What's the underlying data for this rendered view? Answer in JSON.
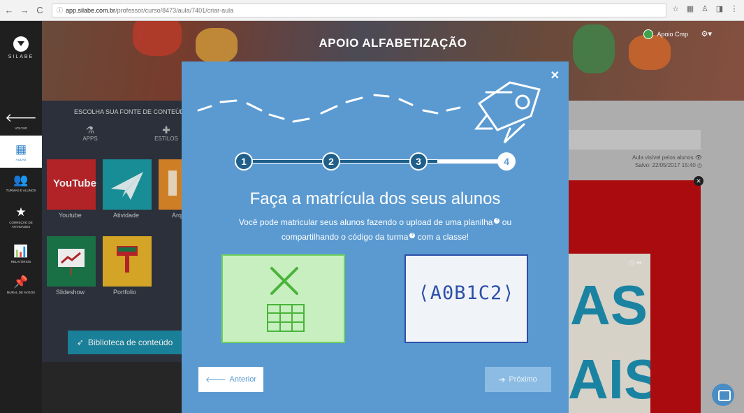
{
  "browser": {
    "url_host": "app.silabe.com.br",
    "url_path": "/professor/curso/8473/aula/7401/criar-aula"
  },
  "sidebar": {
    "logo_text": "SILABE",
    "items": [
      {
        "label": "VOLTAR",
        "icon": "arrow-left-icon"
      },
      {
        "label": "AULAS",
        "icon": "grid-icon"
      },
      {
        "label": "TURMAS E ALUNOS",
        "icon": "users-icon"
      },
      {
        "label": "CORREÇÃO DE ATIVIDADES",
        "icon": "star-icon"
      },
      {
        "label": "RELATÓRIOS",
        "icon": "bar-chart-icon"
      },
      {
        "label": "MURAL DE AVISOS",
        "icon": "pin-icon"
      }
    ]
  },
  "header": {
    "title": "APOIO ALFABETIZAÇÃO",
    "user_name": "Apoio Cmp"
  },
  "content_panel": {
    "title": "ESCOLHA SUA FONTE DE CONTEÚDO",
    "tab_apps": "APPS",
    "tab_styles": "ESTILOS",
    "tiles": [
      {
        "label": "Youtube",
        "logo_text": "YouTube"
      },
      {
        "label": "Atividade"
      },
      {
        "label": "Arq"
      },
      {
        "label": "Slideshow"
      },
      {
        "label": "Portfolio"
      }
    ],
    "library_button": "Biblioteca de conteúdo"
  },
  "editor": {
    "visibility_text": "Aula visível pelos alunos",
    "saved_text": "Salvo: 22/05/2017 15:40"
  },
  "modal": {
    "steps": [
      "1",
      "2",
      "3",
      "4"
    ],
    "current_step": 4,
    "title": "Faça a matrícula dos seus alunos",
    "desc_part1": "Você pode matricular seus alunos fazendo o upload de uma planilha",
    "desc_part2": "ou compartilhando o código da turma",
    "desc_part3": "com a classe!",
    "code_sample": "⟨A0B1C2⟩",
    "prev_button": "Anterior",
    "next_button": "Próximo"
  },
  "colors": {
    "modal_bg": "#5b9ad1",
    "accent_teal": "#1d8aa6",
    "red_card": "#b80d10"
  }
}
